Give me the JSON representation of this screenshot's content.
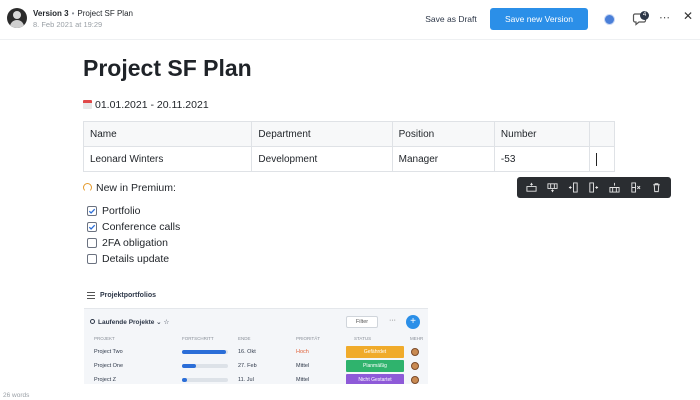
{
  "header": {
    "version_label": "Version 3",
    "separator": "•",
    "doc_name": "Project SF Plan",
    "version_date": "8. Feb 2021 at 19:29",
    "save_draft_label": "Save as Draft",
    "save_version_label": "Save new Version",
    "comment_count": "4",
    "more_label": "⋯",
    "close_label": "✕",
    "accent_color": "#2b8fe8"
  },
  "document": {
    "title": "Project SF Plan",
    "date_range": "01.01.2021 - 20.11.2021",
    "table": {
      "headers": [
        "Name",
        "Department",
        "Position",
        "Number",
        ""
      ],
      "rows": [
        [
          "Leonard Winters",
          "Development",
          "Manager",
          "-53",
          ""
        ]
      ]
    },
    "premium_label": "New in Premium:",
    "checklist": [
      {
        "label": "Portfolio",
        "checked": true
      },
      {
        "label": "Conference calls",
        "checked": true
      },
      {
        "label": "2FA obligation",
        "checked": false
      },
      {
        "label": "Details update",
        "checked": false
      }
    ]
  },
  "table_toolbar": {
    "icons": [
      "insert-row-above-icon",
      "insert-row-below-icon",
      "insert-column-left-icon",
      "insert-column-right-icon",
      "delete-row-icon",
      "delete-column-icon",
      "trash-icon"
    ]
  },
  "embed": {
    "title": "Projektportfolios",
    "search_label": "Laufende Projekte",
    "chevron": "⌄",
    "star": "☆",
    "filter_label": "Filter",
    "more_label": "···",
    "add_label": "+",
    "columns": [
      "PROJEKT",
      "FORTSCHRITT",
      "ENDE",
      "PRIORITÄT",
      "STATUS",
      "MEHR"
    ],
    "rows": [
      {
        "project": "Project Two",
        "progress": 0.95,
        "end": "16. Okt",
        "priority": "Hoch",
        "priority_color": "#e0623a",
        "status": "Gefährdet",
        "status_color": "#f0ab2b"
      },
      {
        "project": "Project One",
        "progress": 0.3,
        "end": "27. Feb",
        "priority": "Mittel",
        "priority_color": "#2d3748",
        "status": "Planmäßig",
        "status_color": "#2fb36d"
      },
      {
        "project": "Project Z",
        "progress": 0.1,
        "end": "11. Jul",
        "priority": "Mittel",
        "priority_color": "#2d3748",
        "status": "Nicht Gestartet",
        "status_color": "#8e5ad8"
      }
    ]
  },
  "footer": {
    "word_count": "26 words"
  }
}
